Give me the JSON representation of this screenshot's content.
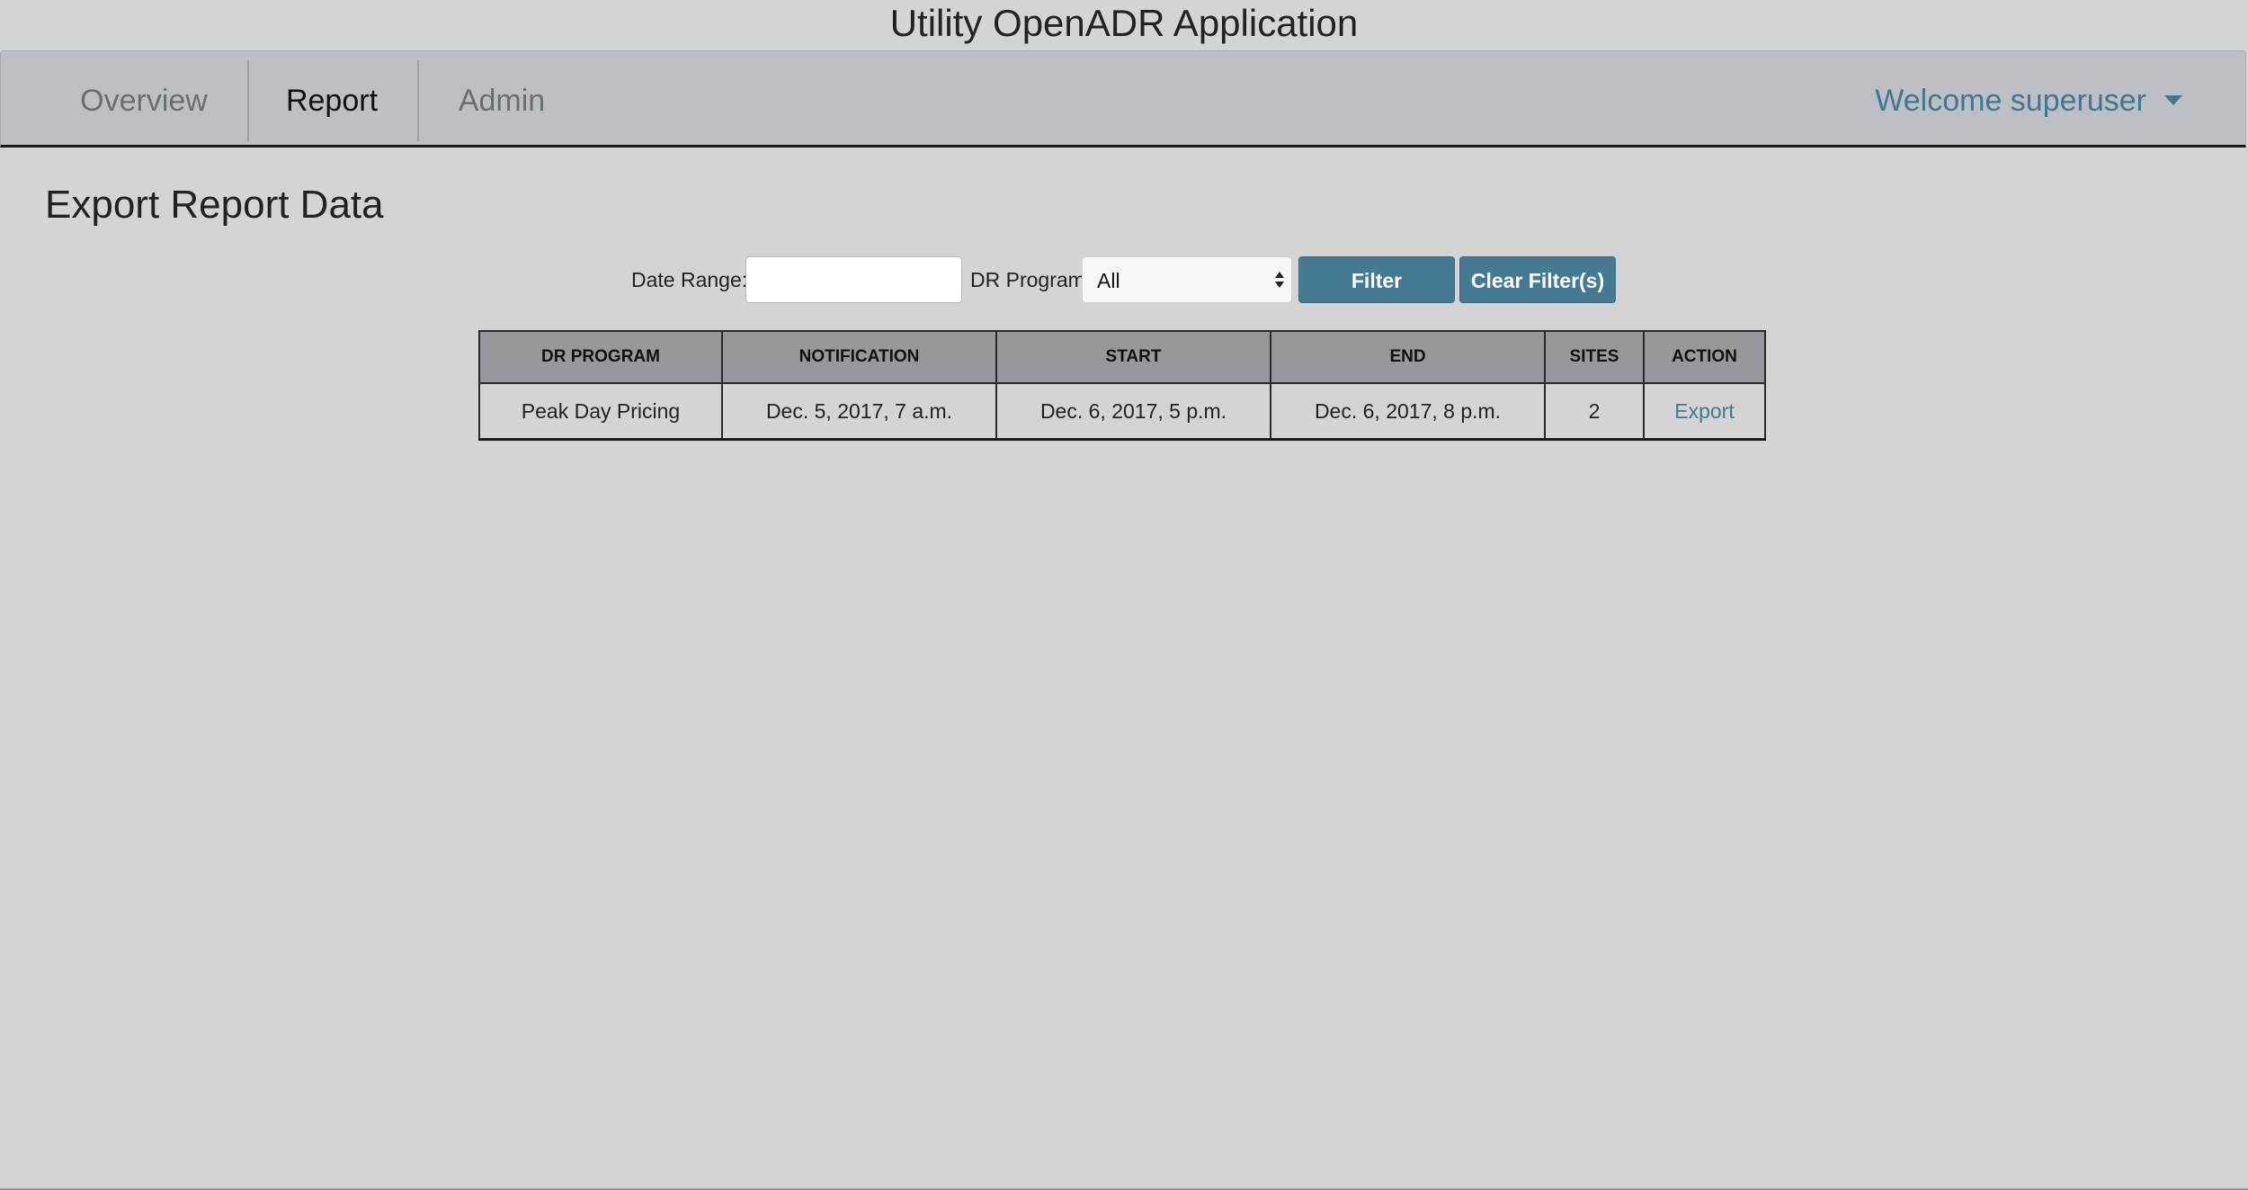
{
  "app": {
    "title": "Utility OpenADR Application"
  },
  "nav": {
    "items": [
      {
        "label": "Overview",
        "active": false
      },
      {
        "label": "Report",
        "active": true
      },
      {
        "label": "Admin",
        "active": false
      }
    ],
    "user_label": "Welcome superuser",
    "user_icon": "caret-down-icon"
  },
  "page": {
    "title": "Export Report Data"
  },
  "filters": {
    "date_range_label": "Date Range:",
    "date_range_value": "",
    "program_label": "DR Program",
    "program_selected": "All",
    "filter_button": "Filter",
    "clear_button": "Clear Filter(s)"
  },
  "table": {
    "headers": [
      "DR PROGRAM",
      "NOTIFICATION",
      "START",
      "END",
      "SITES",
      "ACTION"
    ],
    "rows": [
      {
        "program": "Peak Day Pricing",
        "notification": "Dec. 5, 2017, 7 a.m.",
        "start": "Dec. 6, 2017, 5 p.m.",
        "end": "Dec. 6, 2017, 8 p.m.",
        "sites": "2",
        "action": "Export"
      }
    ]
  },
  "colors": {
    "background": "#d4d4d4",
    "navbar": "#bcc0c4",
    "accent": "#457a93",
    "link": "#3f7890",
    "table_header": "#96989b"
  }
}
